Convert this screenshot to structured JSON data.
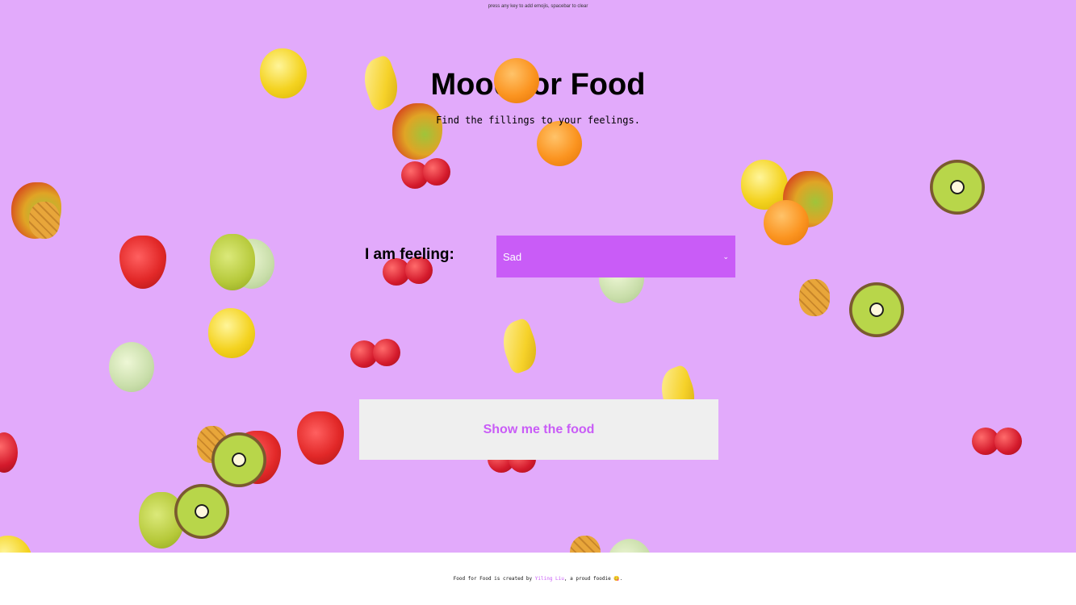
{
  "hint": "press any key to add emojis, spacebar to clear",
  "title": "Mood for Food",
  "subtitle": "Find the fillings to your feelings.",
  "feeling_label": "I am feeling:",
  "select": {
    "value": "Sad",
    "chevron": "⌄"
  },
  "show_button": "Show me the food",
  "footer": {
    "prefix": "Food for Food is created by ",
    "author": "Yiling Liu",
    "suffix": ", a proud foodie 😋."
  },
  "colors": {
    "background": "#e2aafb",
    "accent": "#c95cf7",
    "button_bg": "#efefef",
    "footer_bg": "#ffffff"
  },
  "fruit_emojis": [
    "lemon",
    "banana",
    "orange",
    "mango",
    "cherry",
    "kiwi",
    "pear",
    "melon",
    "strawberry",
    "pineapple"
  ]
}
